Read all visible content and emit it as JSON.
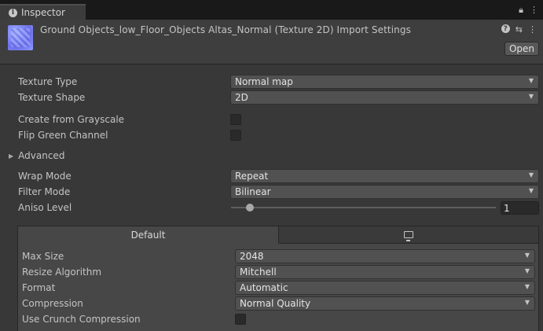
{
  "tab": {
    "label": "Inspector"
  },
  "header": {
    "title": "Ground Objects_low_Floor_Objects Altas_Normal (Texture 2D) Import Settings",
    "open_label": "Open"
  },
  "fields": {
    "texture_type": {
      "label": "Texture Type",
      "value": "Normal map"
    },
    "texture_shape": {
      "label": "Texture Shape",
      "value": "2D"
    },
    "create_from_grayscale": {
      "label": "Create from Grayscale",
      "checked": false
    },
    "flip_green": {
      "label": "Flip Green Channel",
      "checked": false
    },
    "advanced": {
      "label": "Advanced"
    },
    "wrap_mode": {
      "label": "Wrap Mode",
      "value": "Repeat"
    },
    "filter_mode": {
      "label": "Filter Mode",
      "value": "Bilinear"
    },
    "aniso_level": {
      "label": "Aniso Level",
      "value": "1",
      "slider_fraction": 0.07
    }
  },
  "platform": {
    "tabs": [
      {
        "label": "Default"
      },
      {
        "icon": "monitor-icon"
      }
    ],
    "max_size": {
      "label": "Max Size",
      "value": "2048"
    },
    "resize_algorithm": {
      "label": "Resize Algorithm",
      "value": "Mitchell"
    },
    "format": {
      "label": "Format",
      "value": "Automatic"
    },
    "compression": {
      "label": "Compression",
      "value": "Normal Quality"
    },
    "use_crunch": {
      "label": "Use Crunch Compression",
      "checked": false
    }
  }
}
